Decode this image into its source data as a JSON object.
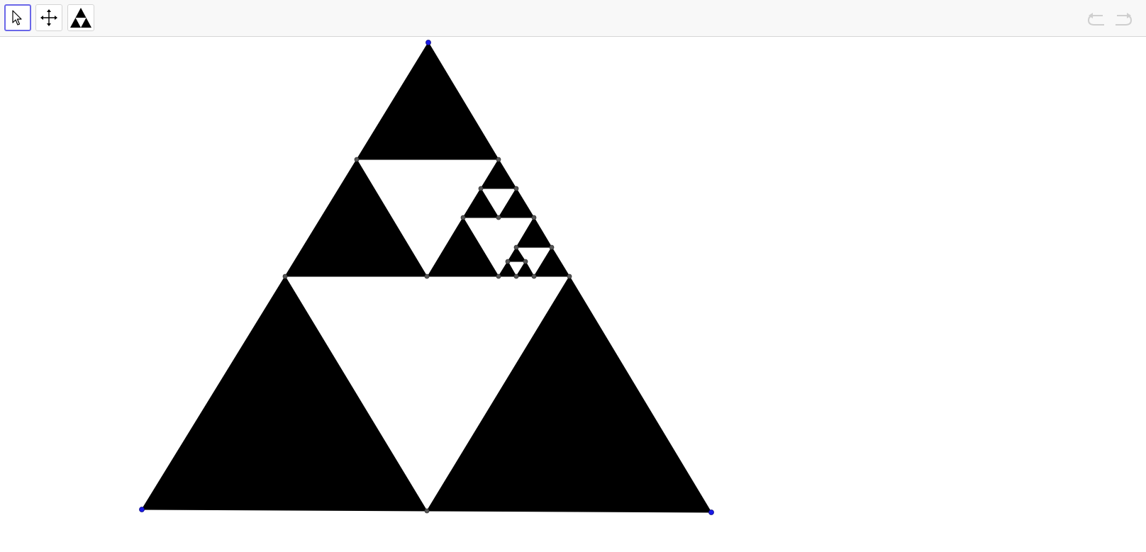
{
  "toolbar": {
    "tools": [
      {
        "name": "move-tool",
        "icon": "arrow-cursor-icon",
        "active": true
      },
      {
        "name": "move-graphics-view-tool",
        "icon": "four-way-arrows-icon",
        "active": false
      },
      {
        "name": "sierpinski-custom-tool",
        "icon": "sierpinski-triangle-icon",
        "active": false
      }
    ],
    "undo": {
      "icon": "undo-icon",
      "enabled": false
    },
    "redo": {
      "icon": "redo-icon",
      "enabled": false
    },
    "active_border_color": "#6a67e8"
  },
  "canvas": {
    "fill_color": "#000000",
    "free_point_color": "#1a1ae6",
    "dependent_point_color": "#555555"
  }
}
